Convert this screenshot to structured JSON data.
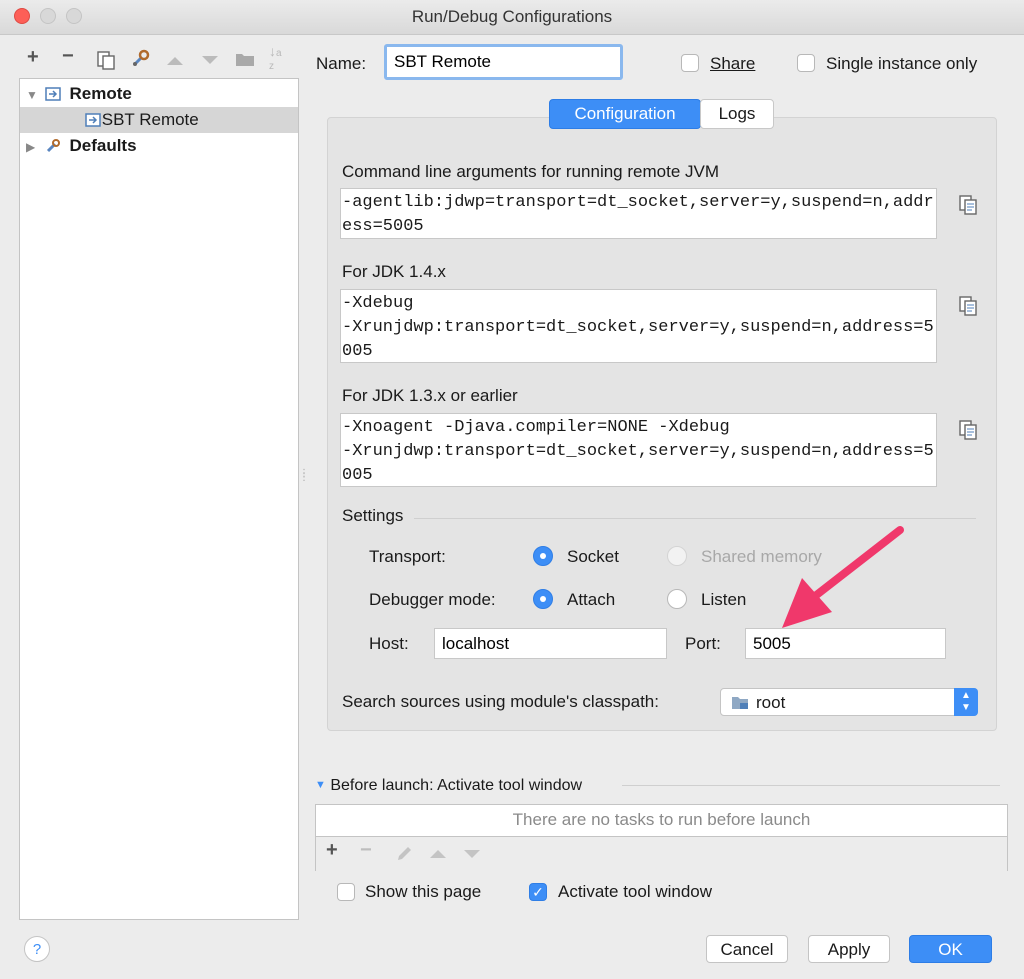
{
  "window": {
    "title": "Run/Debug Configurations"
  },
  "toolbar": {
    "add": "+",
    "remove": "−",
    "copy_icon": "copy-icon",
    "wrench_icon": "wrench-icon",
    "up_icon": "move-up-icon",
    "down_icon": "move-down-icon",
    "folder_icon": "folder-icon",
    "sort_icon": "sort-icon"
  },
  "tree": {
    "items": [
      {
        "label": "Remote",
        "expanded": true
      },
      {
        "label": "SBT Remote",
        "selected": true
      },
      {
        "label": "Defaults",
        "expanded": false
      }
    ]
  },
  "header": {
    "name_label": "Name:",
    "name_value": "SBT Remote",
    "share_label": "Share",
    "single_instance_label": "Single instance only"
  },
  "tabs": [
    {
      "label": "Configuration",
      "active": true
    },
    {
      "label": "Logs",
      "active": false
    }
  ],
  "config": {
    "cmdline_label": "Command line arguments for running remote JVM",
    "cmdline_value": "-agentlib:jdwp=transport=dt_socket,server=y,suspend=n,address=5005",
    "jdk14_label": "For JDK 1.4.x",
    "jdk14_value": "-Xdebug\n-Xrunjdwp:transport=dt_socket,server=y,suspend=n,address=5005",
    "jdk13_label": "For JDK 1.3.x or earlier",
    "jdk13_value": "-Xnoagent -Djava.compiler=NONE -Xdebug\n-Xrunjdwp:transport=dt_socket,server=y,suspend=n,address=5005"
  },
  "settings": {
    "title": "Settings",
    "transport_label": "Transport:",
    "transport_socket": "Socket",
    "transport_shared": "Shared memory",
    "mode_label": "Debugger mode:",
    "mode_attach": "Attach",
    "mode_listen": "Listen",
    "host_label": "Host:",
    "host_value": "localhost",
    "port_label": "Port:",
    "port_value": "5005",
    "classpath_label": "Search sources using module's classpath:",
    "classpath_value": "root"
  },
  "before_launch": {
    "title": "Before launch: Activate tool window",
    "empty_text": "There are no tasks to run before launch"
  },
  "options": {
    "show_page_label": "Show this page",
    "show_page_checked": false,
    "activate_label": "Activate tool window",
    "activate_checked": true
  },
  "buttons": {
    "help": "?",
    "cancel": "Cancel",
    "apply": "Apply",
    "ok": "OK"
  },
  "colors": {
    "accent": "#3d8ef6",
    "annotation_arrow": "#f0386b"
  }
}
